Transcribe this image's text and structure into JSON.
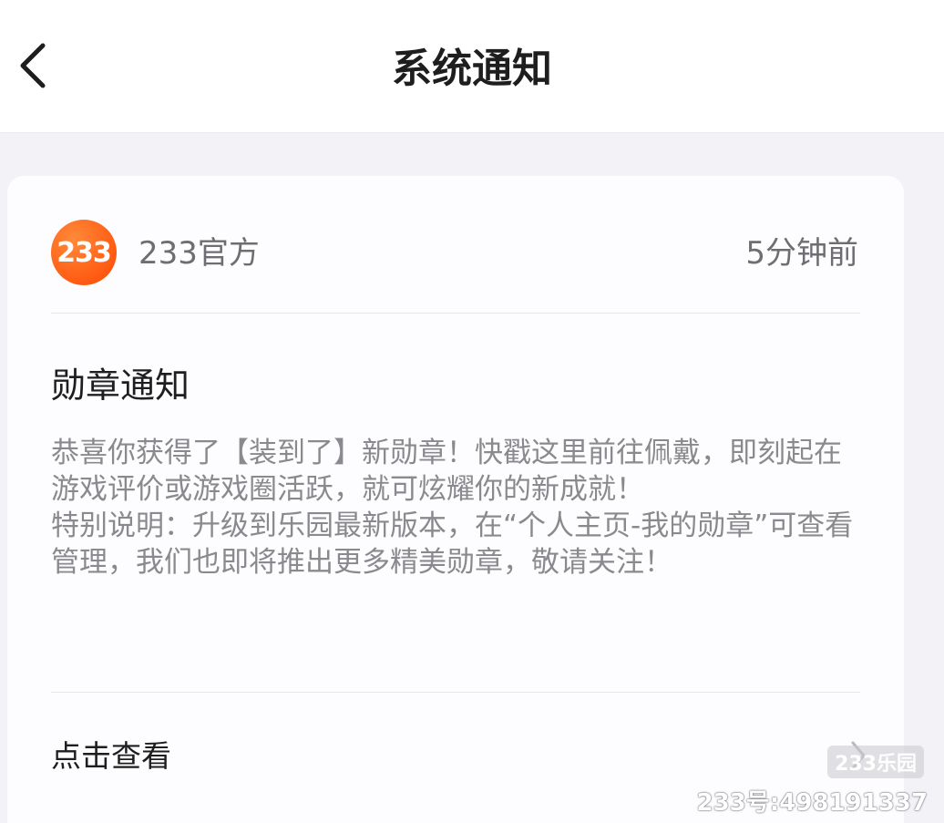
{
  "header": {
    "title": "系统通知",
    "back_icon": "chevron-left-icon"
  },
  "notification": {
    "sender": {
      "avatar_text": "233",
      "name": "233官方"
    },
    "time": "5分钟前",
    "title": "勋章通知",
    "body_paragraph_1": "恭喜你获得了【装到了】新勋章！快戳这里前往佩戴，即刻起在游戏评价或游戏圈活跃，就可炫耀你的新成就！",
    "body_paragraph_2": "特别说明：升级到乐园最新版本，在“个人主页-我的勋章”可查看管理，我们也即将推出更多精美勋章，敬请关注！",
    "action_label": "点击查看",
    "action_icon": "chevron-right-icon"
  },
  "watermark": {
    "logo_text": "233乐园",
    "id_text": "233号:498191337"
  },
  "colors": {
    "avatar_orange": "#ff5a12",
    "page_background": "#f3f2f7",
    "card_background": "#fdfcfe",
    "body_text": "#8a8a8e"
  }
}
